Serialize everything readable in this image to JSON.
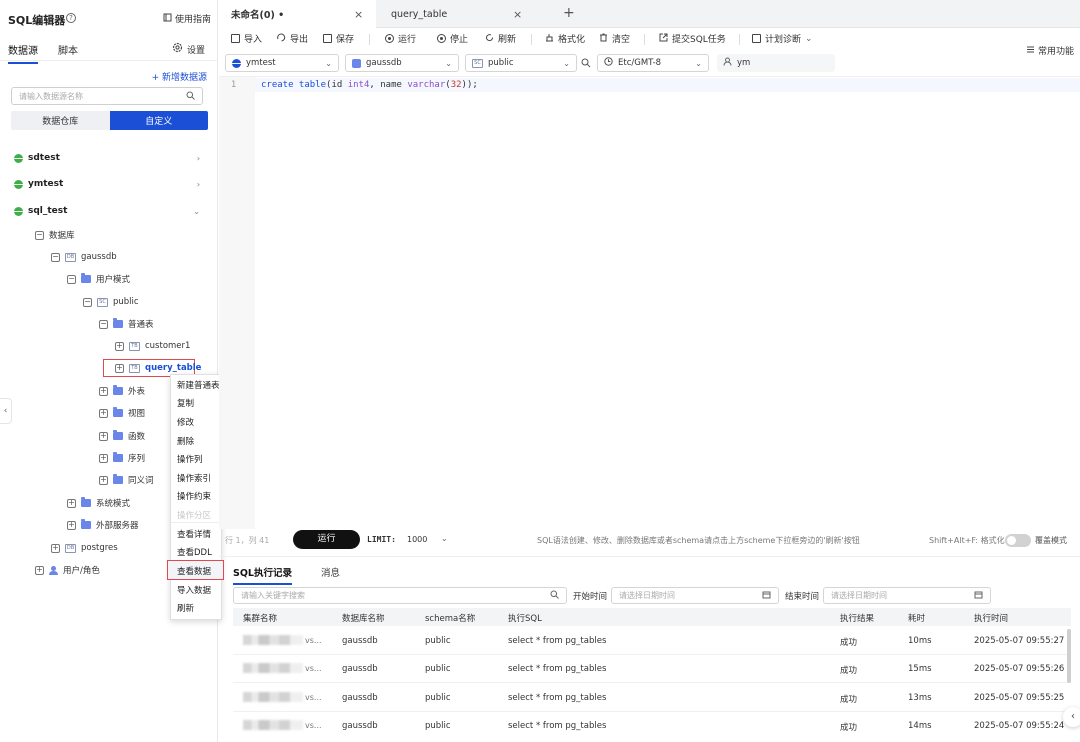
{
  "sidebar": {
    "title": "SQL编辑器",
    "help": "?",
    "guide": "使用指南",
    "tabs": [
      "数据源",
      "脚本"
    ],
    "settings": "设置",
    "add_datasource": "+ 新增数据源",
    "search_placeholder": "请输入数据源名称",
    "segments": [
      "数据仓库",
      "自定义"
    ],
    "tree": {
      "sdtest": "sdtest",
      "ymtest": "ymtest",
      "sql_test": "sql_test",
      "database": "数据库",
      "gaussdb": "gaussdb",
      "user_schema": "用户模式",
      "public": "public",
      "normal_table": "普通表",
      "customer1": "customer1",
      "query_table": "query_table",
      "foreign_table": "外表",
      "view": "视图",
      "function": "函数",
      "sequence": "序列",
      "synonym": "同义词",
      "system_schema": "系统模式",
      "external_server": "外部服务器",
      "postgres": "postgres",
      "user_role": "用户/角色",
      "tag_db": "DB",
      "tag_sc": "SC",
      "tag_tb": "TB"
    }
  },
  "context_menu": {
    "items": [
      "新建普通表",
      "复制",
      "修改",
      "删除",
      "操作列",
      "操作索引",
      "操作约束",
      "操作分区",
      "查看详情",
      "查看DDL",
      "查看数据",
      "导入数据",
      "刷新"
    ]
  },
  "editor_tabs": {
    "tab1": "未命名(0) •",
    "tab2": "query_table",
    "close": "×",
    "add": "+"
  },
  "toolbar": {
    "import": "导入",
    "export": "导出",
    "save": "保存",
    "run": "运行",
    "stop": "停止",
    "refresh": "刷新",
    "format": "格式化",
    "clear": "清空",
    "submit": "提交SQL任务",
    "plan": "计划诊断",
    "common": "常用功能"
  },
  "selectors": {
    "datasource": "ymtest",
    "database": "gaussdb",
    "schema": "public",
    "timezone": "Etc/GMT-8",
    "user": "ym"
  },
  "editor": {
    "line": "1",
    "code": {
      "kw1": "create table",
      "p1": "(id ",
      "t1": "int4",
      "p2": ", name ",
      "t2": "varchar",
      "p3": "(",
      "n1": "32",
      "p4": "));"
    }
  },
  "runbar": {
    "position": "行 1，列 41",
    "run": "运行",
    "limit_label": "LIMIT:",
    "limit_value": "1000",
    "hint": "SQL语法创建、修改、删除数据库或者schema请点击上方scheme下拉框旁边的'刷新'按钮",
    "shortcut": "Shift+Alt+F: 格式化",
    "cover_mode": "覆盖模式"
  },
  "results": {
    "tabs": [
      "SQL执行记录",
      "消息"
    ],
    "search_placeholder": "请输入关键字搜索",
    "start_label": "开始时间",
    "start_placeholder": "请选择日期时间",
    "end_label": "结束时间",
    "end_placeholder": "请选择日期时间",
    "columns": [
      "集群名称",
      "数据库名称",
      "schema名称",
      "执行SQL",
      "执行结果",
      "耗时",
      "执行时间"
    ],
    "rows": [
      {
        "suffix": "vs...",
        "db": "gaussdb",
        "schema": "public",
        "sql": "select * from pg_tables",
        "result": "成功",
        "cost": "10ms",
        "time": "2025-05-07 09:55:27"
      },
      {
        "suffix": "vs...",
        "db": "gaussdb",
        "schema": "public",
        "sql": "select * from pg_tables",
        "result": "成功",
        "cost": "15ms",
        "time": "2025-05-07 09:55:26"
      },
      {
        "suffix": "vs...",
        "db": "gaussdb",
        "schema": "public",
        "sql": "select * from pg_tables",
        "result": "成功",
        "cost": "13ms",
        "time": "2025-05-07 09:55:25"
      },
      {
        "suffix": "vs...",
        "db": "gaussdb",
        "schema": "public",
        "sql": "select * from pg_tables",
        "result": "成功",
        "cost": "14ms",
        "time": "2025-05-07 09:55:24"
      }
    ]
  },
  "colors": {
    "accent": "#1a4fd6",
    "highlight_border": "#e0494f",
    "globe": "#3fae49"
  }
}
